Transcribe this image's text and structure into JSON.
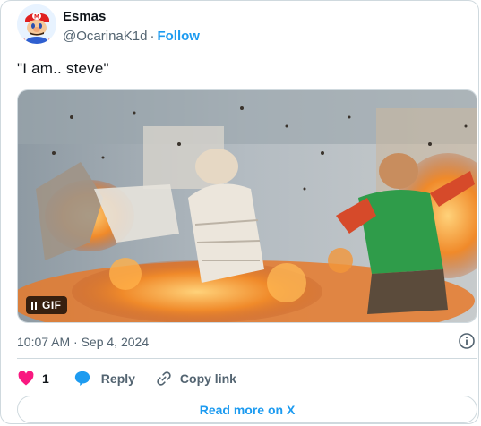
{
  "author": {
    "name": "Esmas",
    "handle": "@OcarinaK1d",
    "separator": "·",
    "follow_label": "Follow",
    "avatar_icon": "mario-avatar"
  },
  "tweet": {
    "text": "\"I am.. steve\""
  },
  "media": {
    "type": "gif",
    "badge_label": "GIF",
    "control_icon": "pause-icon",
    "description_colors": {
      "fire": "#f08a2a",
      "wall": "#a7b2b8",
      "shirt_green": "#2f9c4a",
      "shirt_white": "#e9e2d8"
    }
  },
  "meta": {
    "timestamp": "10:07 AM · Sep 4, 2024",
    "info_icon": "info-icon"
  },
  "actions": {
    "like_count": "1",
    "reply_label": "Reply",
    "copy_label": "Copy link"
  },
  "footer": {
    "read_more_label": "Read more on X"
  },
  "colors": {
    "accent": "#1d9bf0",
    "like": "#f91880",
    "muted_text": "#536471",
    "border": "#cfd9de"
  }
}
